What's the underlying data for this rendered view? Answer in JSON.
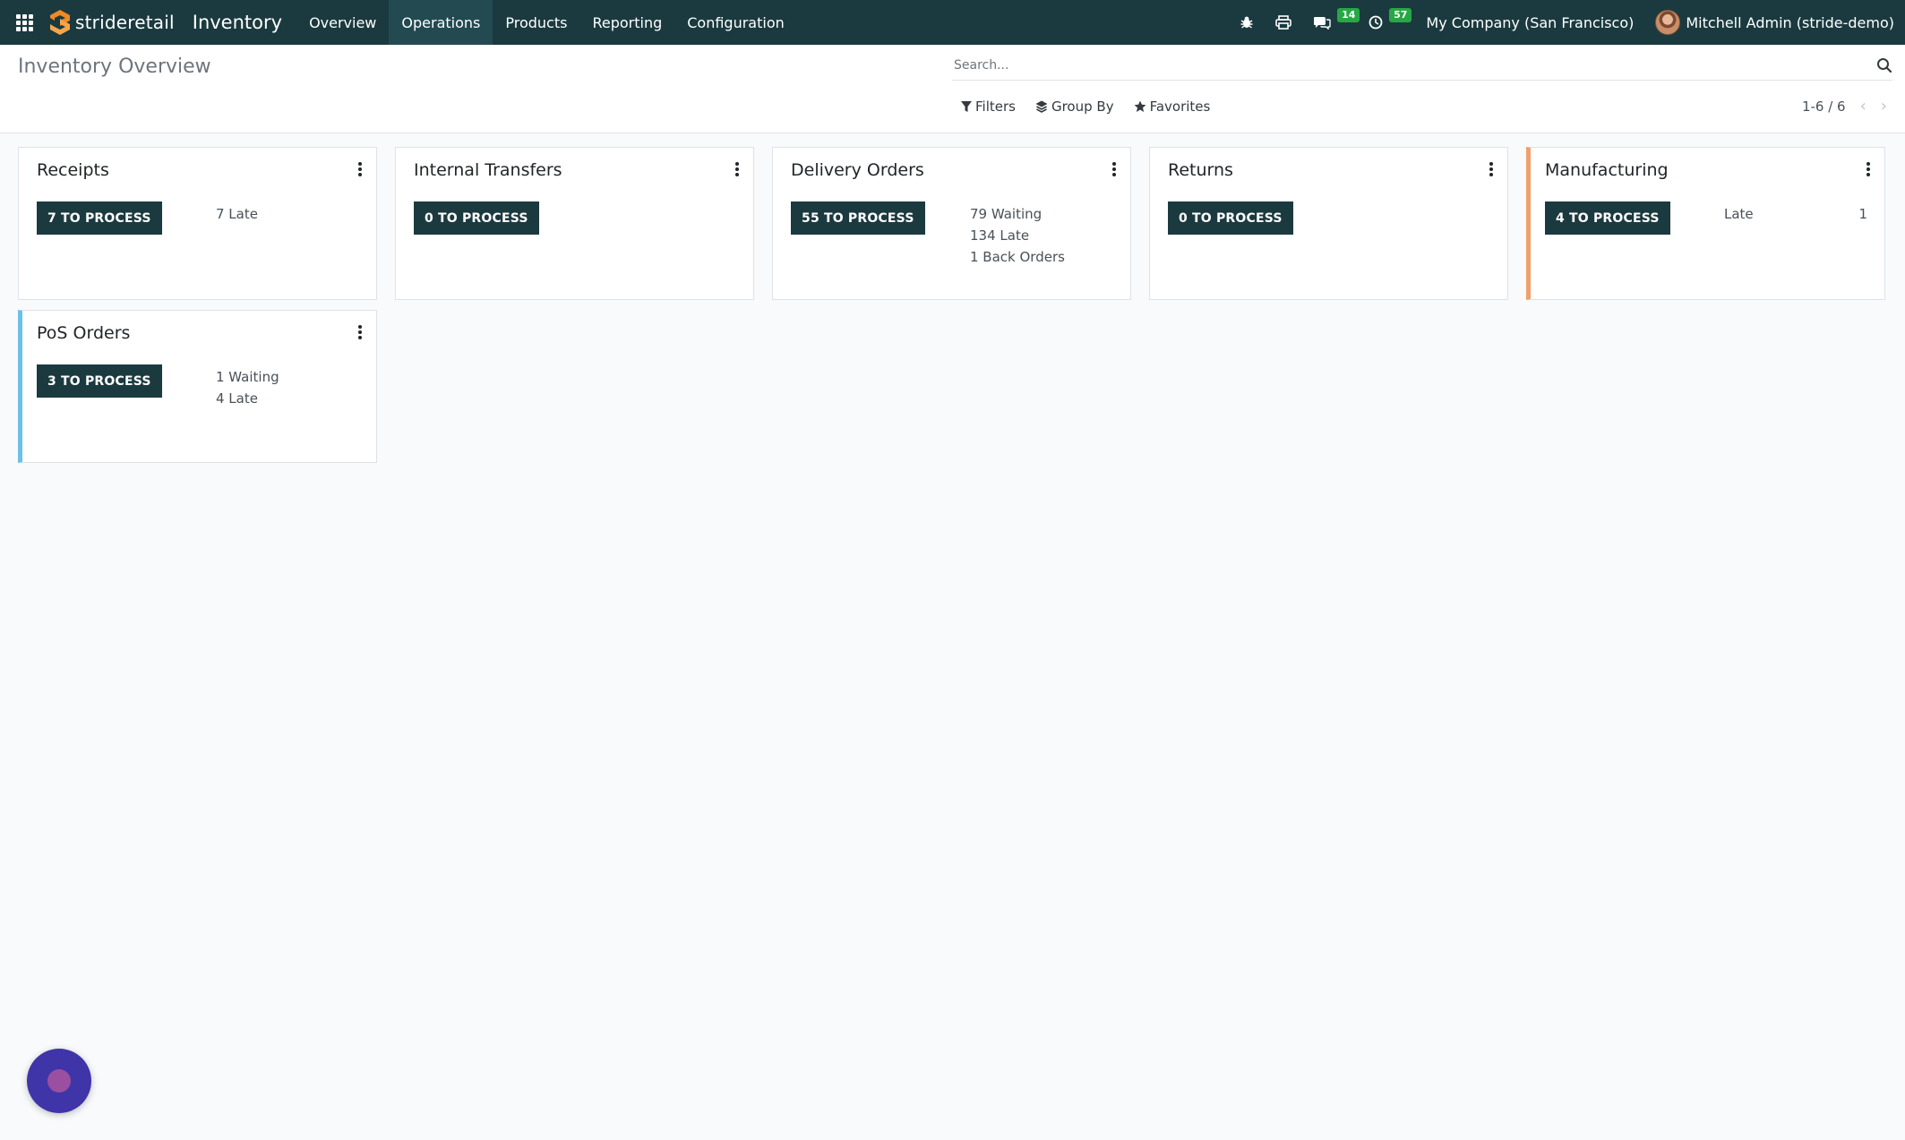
{
  "navbar": {
    "brand_prefix": "stride",
    "brand_suffix": "retail",
    "app_title": "Inventory",
    "menu": [
      "Overview",
      "Operations",
      "Products",
      "Reporting",
      "Configuration"
    ],
    "active_menu": "Operations",
    "messages_count": "14",
    "activities_count": "57",
    "company": "My Company (San Francisco)",
    "user": "Mitchell Admin (stride-demo)",
    "bg_color": "#1b3a40",
    "badge_color": "#28a745"
  },
  "control_panel": {
    "title": "Inventory Overview",
    "search_placeholder": "Search...",
    "filters_label": "Filters",
    "group_by_label": "Group By",
    "favorites_label": "Favorites",
    "pager": "1-6 / 6"
  },
  "cards": [
    {
      "title": "Receipts",
      "button": "7 TO PROCESS",
      "stats": [
        {
          "label": "7 Late",
          "value": ""
        }
      ]
    },
    {
      "title": "Internal Transfers",
      "button": "0 TO PROCESS",
      "stats": []
    },
    {
      "title": "Delivery Orders",
      "button": "55 TO PROCESS",
      "stats": [
        {
          "label": "79 Waiting",
          "value": ""
        },
        {
          "label": "134 Late",
          "value": ""
        },
        {
          "label": "1 Back Orders",
          "value": ""
        }
      ]
    },
    {
      "title": "Returns",
      "button": "0 TO PROCESS",
      "stats": []
    },
    {
      "title": "Manufacturing",
      "button": "4 TO PROCESS",
      "stats": [
        {
          "label": "Late",
          "value": "1"
        }
      ],
      "accent": "#f0a06a"
    },
    {
      "title": "PoS Orders",
      "button": "3 TO PROCESS",
      "stats": [
        {
          "label": "1 Waiting",
          "value": ""
        },
        {
          "label": "4 Late",
          "value": ""
        }
      ],
      "accent": "#6cc1e8"
    }
  ]
}
